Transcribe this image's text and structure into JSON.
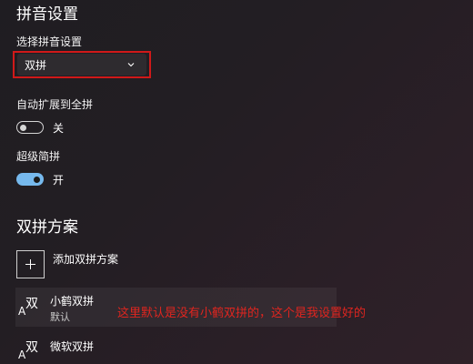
{
  "header": {
    "title": "拼音设置"
  },
  "pinyin_select": {
    "label": "选择拼音设置",
    "selected": "双拼",
    "dropdown_icon": "chevron-down-icon",
    "highlight_color": "#d01919"
  },
  "auto_expand": {
    "label": "自动扩展到全拼",
    "state": "关",
    "enabled": false
  },
  "super_simple": {
    "label": "超级简拼",
    "state": "开",
    "enabled": true,
    "accent_color": "#76b9ed"
  },
  "shuangpin": {
    "title": "双拼方案",
    "add_label": "添加双拼方案",
    "add_icon": "plus-icon",
    "schemes": [
      {
        "name": "小鹤双拼",
        "sub": "默认",
        "icon": "ime-language-icon"
      },
      {
        "name": "微软双拼",
        "icon": "ime-language-icon"
      }
    ]
  },
  "annotation": {
    "text": "这里默认是没有小鹤双拼的，这个是我设置好的",
    "color": "#e0251f"
  }
}
